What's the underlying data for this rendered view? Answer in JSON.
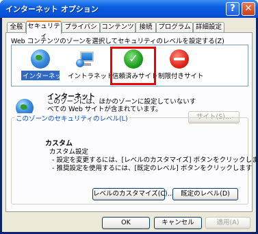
{
  "window": {
    "title": "インターネット オプション"
  },
  "title_buttons": {
    "help": "?",
    "close": "✕"
  },
  "tabs": [
    {
      "label": "全般"
    },
    {
      "label": "セキュリティ"
    },
    {
      "label": "プライバシー"
    },
    {
      "label": "コンテンツ"
    },
    {
      "label": "接続"
    },
    {
      "label": "プログラム"
    },
    {
      "label": "詳細設定"
    }
  ],
  "active_tab": "セキュリティ",
  "instructions": "Web コンテンツのゾーンを選択してセキュリティのレベルを設定する(Z)",
  "zones": [
    {
      "label": "インターネット",
      "icon": "internet-globe-icon",
      "selected": true
    },
    {
      "label": "イントラネット",
      "icon": "intranet-monitor-icon",
      "selected": false
    },
    {
      "label": "信頼済みサイト",
      "icon": "trusted-check-icon",
      "selected": false
    },
    {
      "label": "制限付きサイト",
      "icon": "restricted-no-entry-icon",
      "selected": false
    }
  ],
  "zone_info": {
    "title": "インターネット",
    "description": "このゾーンには、ほかのゾーンに設定していないすべての Web サイトが含まれています。",
    "sites_button": "サイト(S)..."
  },
  "security_level": {
    "group_label": "このゾーンのセキュリティのレベル(L)",
    "level_name": "カスタム",
    "level_subtitle": "カスタム設定",
    "line1": "- 設定を変更するには、[レベルのカスタマイズ] ボタンをクリックします",
    "line2": "- 推奨設定を使用するには、[既定のレベル] ボタンをクリックします",
    "customize_button": "レベルのカスタマイズ(C)...",
    "default_button": "既定のレベル(D)"
  },
  "footer": {
    "ok": "OK",
    "cancel": "キャンセル",
    "apply": "適用(A)"
  },
  "colors": {
    "highlight_box": "#e00000",
    "selection": "#316ac5",
    "titlebar": "#0a5ee0"
  }
}
